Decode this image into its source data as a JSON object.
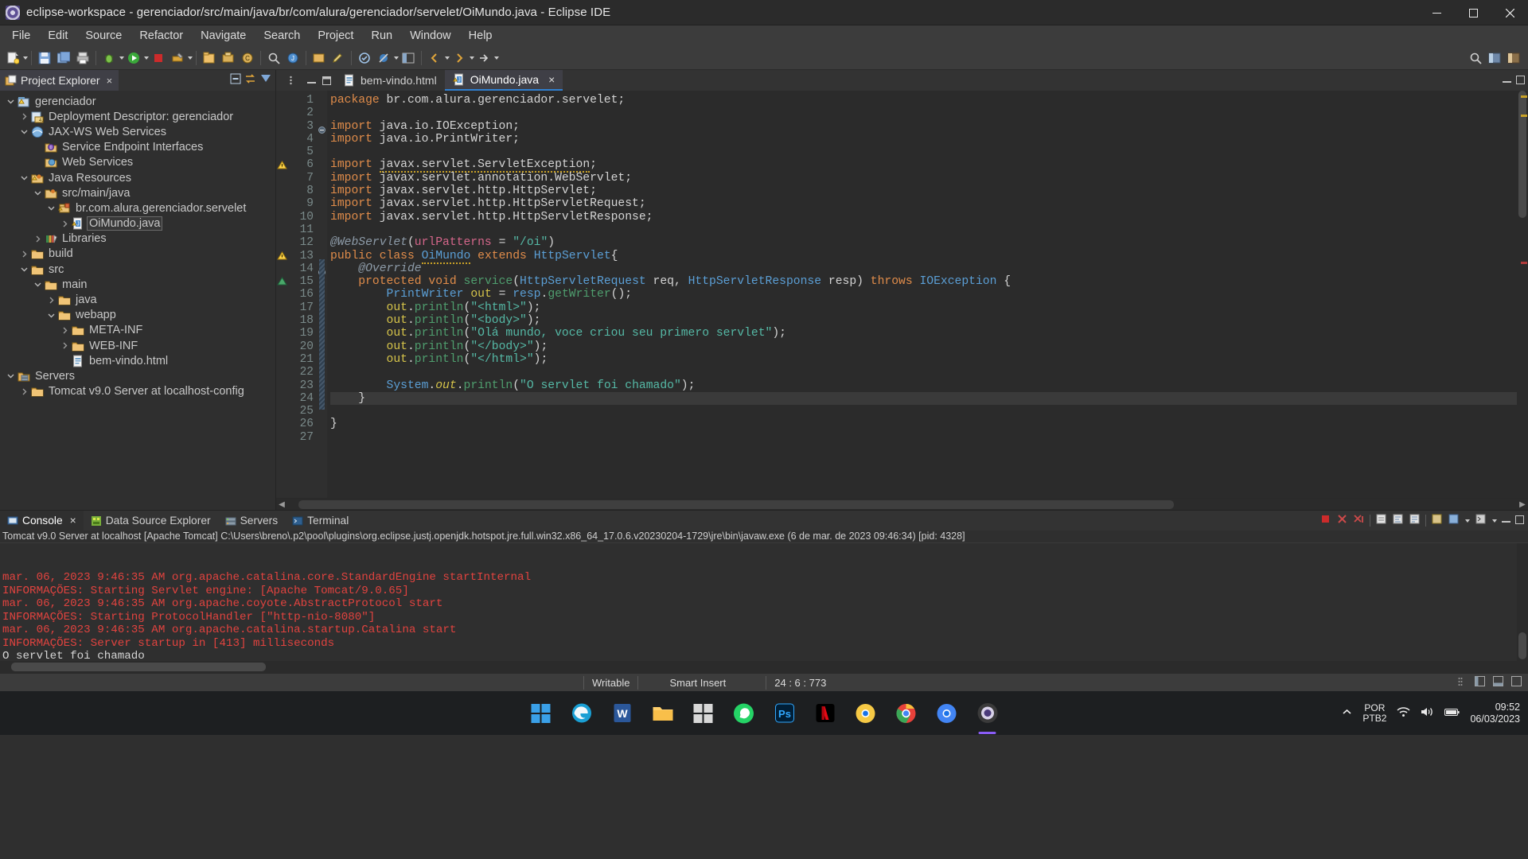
{
  "window": {
    "title": "eclipse-workspace - gerenciador/src/main/java/br/com/alura/gerenciador/servelet/OiMundo.java - Eclipse IDE",
    "minimize_label": "Minimize",
    "maximize_label": "Maximize",
    "close_label": "Close"
  },
  "menubar": {
    "items": [
      "File",
      "Edit",
      "Source",
      "Refactor",
      "Navigate",
      "Search",
      "Project",
      "Run",
      "Window",
      "Help"
    ]
  },
  "explorer": {
    "tab_label": "Project Explorer",
    "close_label": "×",
    "tools": [
      "collapse-all-icon",
      "link-with-editor-icon",
      "view-menu-icon"
    ],
    "tree": [
      {
        "label": "gerenciador",
        "indent": 0,
        "arrow": "down",
        "icon": "project-warning"
      },
      {
        "label": "Deployment Descriptor: gerenciador",
        "indent": 1,
        "arrow": "right",
        "icon": "deployment-descriptor"
      },
      {
        "label": "JAX-WS Web Services",
        "indent": 1,
        "arrow": "down",
        "icon": "jaxws"
      },
      {
        "label": "Service Endpoint Interfaces",
        "indent": 2,
        "arrow": "none",
        "icon": "endpoint"
      },
      {
        "label": "Web Services",
        "indent": 2,
        "arrow": "none",
        "icon": "webservices"
      },
      {
        "label": "Java Resources",
        "indent": 1,
        "arrow": "down",
        "icon": "java-resources"
      },
      {
        "label": "src/main/java",
        "indent": 2,
        "arrow": "down",
        "icon": "source-folder"
      },
      {
        "label": "br.com.alura.gerenciador.servelet",
        "indent": 3,
        "arrow": "down",
        "icon": "package"
      },
      {
        "label": "OiMundo.java",
        "indent": 4,
        "arrow": "right",
        "icon": "java-file",
        "selected": true
      },
      {
        "label": "Libraries",
        "indent": 2,
        "arrow": "right",
        "icon": "libraries"
      },
      {
        "label": "build",
        "indent": 1,
        "arrow": "right",
        "icon": "folder"
      },
      {
        "label": "src",
        "indent": 1,
        "arrow": "down",
        "icon": "folder"
      },
      {
        "label": "main",
        "indent": 2,
        "arrow": "down",
        "icon": "folder"
      },
      {
        "label": "java",
        "indent": 3,
        "arrow": "right",
        "icon": "folder"
      },
      {
        "label": "webapp",
        "indent": 3,
        "arrow": "down",
        "icon": "folder"
      },
      {
        "label": "META-INF",
        "indent": 4,
        "arrow": "right",
        "icon": "folder"
      },
      {
        "label": "WEB-INF",
        "indent": 4,
        "arrow": "right",
        "icon": "folder"
      },
      {
        "label": "bem-vindo.html",
        "indent": 4,
        "arrow": "none",
        "icon": "html-file"
      },
      {
        "label": "Servers",
        "indent": 0,
        "arrow": "down",
        "icon": "servers-folder"
      },
      {
        "label": "Tomcat v9.0 Server at localhost-config",
        "indent": 1,
        "arrow": "right",
        "icon": "folder"
      }
    ]
  },
  "editor": {
    "tabs": [
      {
        "label": "bem-vindo.html",
        "icon": "html-file-icon",
        "active": false,
        "closable": false
      },
      {
        "label": "OiMundo.java",
        "icon": "java-file-icon",
        "active": true,
        "closable": true
      }
    ],
    "close_label": "×",
    "first_line": 1,
    "last_line": 27,
    "lines": [
      {
        "n": 1,
        "html": "<span class=\"kw\">package</span> br.com.alura.gerenciador.servelet;"
      },
      {
        "n": 2,
        "html": ""
      },
      {
        "n": 3,
        "html": "<span class=\"kw\">import</span> java.io.IOException;",
        "fold": "collapse"
      },
      {
        "n": 4,
        "html": "<span class=\"kw\">import</span> java.io.PrintWriter;"
      },
      {
        "n": 5,
        "html": ""
      },
      {
        "n": 6,
        "html": "<span class=\"kw\">import</span> <span class=\"wav\">javax.servlet.ServletException</span>;",
        "mark": "warning"
      },
      {
        "n": 7,
        "html": "<span class=\"kw\">import</span> javax.servlet.annotation.WebServlet;"
      },
      {
        "n": 8,
        "html": "<span class=\"kw\">import</span> javax.servlet.http.HttpServlet;"
      },
      {
        "n": 9,
        "html": "<span class=\"kw\">import</span> javax.servlet.http.HttpServletRequest;"
      },
      {
        "n": 10,
        "html": "<span class=\"kw\">import</span> javax.servlet.http.HttpServletResponse;"
      },
      {
        "n": 11,
        "html": ""
      },
      {
        "n": 12,
        "html": "<span class=\"ann\">@WebServlet</span>(<span class=\"pnk\">urlPatterns</span> = <span class=\"str\">\"/oi\"</span>)"
      },
      {
        "n": 13,
        "html": "<span class=\"kw\">public</span> <span class=\"kw\">class</span> <span class=\"typ wav\">OiMundo</span> <span class=\"kw\">extends</span> <span class=\"typ\">HttpServlet</span>{",
        "mark": "warning"
      },
      {
        "n": 14,
        "html": "    <span class=\"ann\">@Override</span>",
        "fold": "collapse"
      },
      {
        "n": 15,
        "html": "    <span class=\"kw\">protected</span> <span class=\"kw\">void</span> <span class=\"mth\">service</span>(<span class=\"typ\">HttpServletRequest</span> req, <span class=\"typ\">HttpServletResponse</span> resp) <span class=\"kw\">throws</span> <span class=\"typ\">IOException</span> {",
        "mark": "override"
      },
      {
        "n": 16,
        "html": "        <span class=\"typ\">PrintWriter</span> <span class=\"fld\">out</span> = <span class=\"typ\">resp</span>.<span class=\"mth\">getWriter</span>();"
      },
      {
        "n": 17,
        "html": "        <span class=\"fld\">out</span>.<span class=\"mth\">println</span>(<span class=\"str\">\"&lt;html&gt;\"</span>);"
      },
      {
        "n": 18,
        "html": "        <span class=\"fld\">out</span>.<span class=\"mth\">println</span>(<span class=\"str\">\"&lt;body&gt;\"</span>);"
      },
      {
        "n": 19,
        "html": "        <span class=\"fld\">out</span>.<span class=\"mth\">println</span>(<span class=\"str\">\"Olá mundo, voce criou seu primero servlet\"</span>);"
      },
      {
        "n": 20,
        "html": "        <span class=\"fld\">out</span>.<span class=\"mth\">println</span>(<span class=\"str\">\"&lt;/body&gt;\"</span>);"
      },
      {
        "n": 21,
        "html": "        <span class=\"fld\">out</span>.<span class=\"mth\">println</span>(<span class=\"str\">\"&lt;/html&gt;\"</span>);"
      },
      {
        "n": 22,
        "html": ""
      },
      {
        "n": 23,
        "html": "        <span class=\"typ\">System</span>.<span class=\"fld\" style=\"font-style:italic\">out</span>.<span class=\"mth\">println</span>(<span class=\"str\">\"O servlet foi chamado\"</span>);"
      },
      {
        "n": 24,
        "html": "    }",
        "current": true
      },
      {
        "n": 25,
        "html": ""
      },
      {
        "n": 26,
        "html": "}"
      },
      {
        "n": 27,
        "html": ""
      }
    ]
  },
  "console": {
    "tabs": [
      {
        "label": "Console",
        "icon": "console-icon",
        "active": true,
        "closable": true
      },
      {
        "label": "Data Source Explorer",
        "icon": "datasource-icon",
        "active": false,
        "closable": false
      },
      {
        "label": "Servers",
        "icon": "servers-icon",
        "active": false,
        "closable": false
      },
      {
        "label": "Terminal",
        "icon": "terminal-icon",
        "active": false,
        "closable": false
      }
    ],
    "close_label": "×",
    "header": "Tomcat v9.0 Server at localhost [Apache Tomcat] C:\\Users\\breno\\.p2\\pool\\plugins\\org.eclipse.justj.openjdk.hotspot.jre.full.win32.x86_64_17.0.6.v20230204-1729\\jre\\bin\\javaw.exe  (6 de mar. de 2023 09:46:34) [pid: 4328]",
    "lines": [
      {
        "text": "mar. 06, 2023 9:46:35 AM org.apache.catalina.core.StandardEngine startInternal",
        "type": "err"
      },
      {
        "text": "INFORMAÇÕES: Starting Servlet engine: [Apache Tomcat/9.0.65]",
        "type": "err"
      },
      {
        "text": "mar. 06, 2023 9:46:35 AM org.apache.coyote.AbstractProtocol start",
        "type": "err"
      },
      {
        "text": "INFORMAÇÕES: Starting ProtocolHandler [\"http-nio-8080\"]",
        "type": "err"
      },
      {
        "text": "mar. 06, 2023 9:46:35 AM org.apache.catalina.startup.Catalina start",
        "type": "err"
      },
      {
        "text": "INFORMAÇÕES: Server startup in [413] milliseconds",
        "type": "err"
      },
      {
        "text": "O servlet foi chamado",
        "type": "out"
      }
    ]
  },
  "statusbar": {
    "writable": "Writable",
    "insert_mode": "Smart Insert",
    "position": "24 : 6 : 773"
  },
  "taskbar": {
    "icons": [
      "windows-start-icon",
      "edge-icon",
      "word-icon",
      "file-explorer-icon",
      "microsoft-store-icon",
      "whatsapp-icon",
      "photoshop-icon",
      "netflix-icon",
      "chrome-canary-icon",
      "chrome-icon",
      "chrome-beta-icon",
      "eclipse-icon"
    ],
    "language_line1": "POR",
    "language_line2": "PTB2",
    "time": "09:52",
    "date": "06/03/2023",
    "show_hidden_label": "Show hidden icons"
  },
  "colors": {
    "accent": "#2f7fd0",
    "error_text": "#e1433f",
    "editor_bg": "#2b2b2b",
    "panel_bg": "#2f2f2f",
    "string": "#55b9a6",
    "keyword": "#e08c4a"
  }
}
